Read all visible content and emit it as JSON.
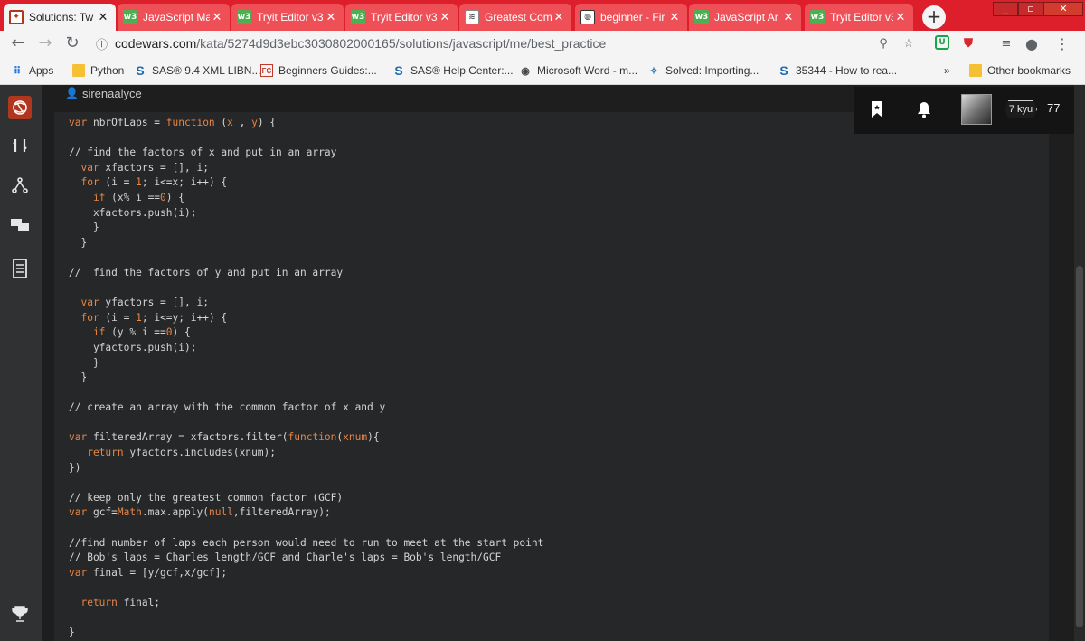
{
  "browser": {
    "tabs": [
      {
        "title": "Solutions: Tw",
        "favicon": "codewars-icon",
        "active": true
      },
      {
        "title": "JavaScript Ma",
        "favicon": "w3schools-icon",
        "active": false
      },
      {
        "title": "Tryit Editor v3",
        "favicon": "w3schools-icon",
        "active": false
      },
      {
        "title": "Tryit Editor v3",
        "favicon": "w3schools-icon",
        "active": false
      },
      {
        "title": "Greatest Com",
        "favicon": "stackoverflow-icon",
        "active": false
      },
      {
        "title": "beginner - Fir",
        "favicon": "globe-icon",
        "active": false
      },
      {
        "title": "JavaScript Ar",
        "favicon": "w3schools-icon",
        "active": false
      },
      {
        "title": "Tryit Editor v3",
        "favicon": "w3schools-icon",
        "active": false
      }
    ],
    "close_glyph": "✕",
    "new_tab_glyph": "+",
    "url_host": "codewars.com",
    "url_path": "/kata/5274d9d3ebc3030802000165/solutions/javascript/me/best_practice",
    "bookmarks": [
      {
        "label": "Apps",
        "icon": "apps-grid-icon"
      },
      {
        "label": "Python",
        "icon": "folder-icon"
      },
      {
        "label": "SAS® 9.4 XML LIBN...",
        "icon": "sas-icon"
      },
      {
        "label": "Beginners Guides:...",
        "icon": "fc-icon"
      },
      {
        "label": "SAS® Help Center:...",
        "icon": "sas-icon"
      },
      {
        "label": "Microsoft Word - m...",
        "icon": "globe-icon"
      },
      {
        "label": "Solved: Importing...",
        "icon": "sparkle-icon"
      },
      {
        "label": "35344 - How to rea...",
        "icon": "sas-icon"
      }
    ],
    "bookmarks_overflow": "»",
    "other_bookmarks": "Other bookmarks"
  },
  "page": {
    "username": "sirenaalyce",
    "rank": "7 kyu",
    "honor": "77"
  },
  "code_lines": [
    [
      [
        "kw",
        "var "
      ],
      [
        "",
        "nbrOfLaps = "
      ],
      [
        "kw",
        "function "
      ],
      [
        "",
        "("
      ],
      [
        "num",
        "x"
      ],
      [
        "",
        " , "
      ],
      [
        "num",
        "y"
      ],
      [
        "",
        ") {"
      ]
    ],
    [
      [
        "",
        ""
      ]
    ],
    [
      [
        "cm",
        "// find the factors of x and put in an array"
      ]
    ],
    [
      [
        "kw",
        "  var "
      ],
      [
        "",
        "xfactors = [], i;"
      ]
    ],
    [
      [
        "kw",
        "  for "
      ],
      [
        "",
        "(i = "
      ],
      [
        "num",
        "1"
      ],
      [
        "",
        "; i<=x; i++) {"
      ]
    ],
    [
      [
        "kw",
        "    if "
      ],
      [
        "",
        "(x% i =="
      ],
      [
        "num",
        "0"
      ],
      [
        "",
        ") {"
      ]
    ],
    [
      [
        "",
        "    xfactors.push(i);"
      ]
    ],
    [
      [
        "",
        "    }"
      ]
    ],
    [
      [
        "",
        "  }"
      ]
    ],
    [
      [
        "",
        ""
      ]
    ],
    [
      [
        "cm",
        "//  find the factors of y and put in an array"
      ]
    ],
    [
      [
        "",
        ""
      ]
    ],
    [
      [
        "kw",
        "  var "
      ],
      [
        "",
        "yfactors = [], i;"
      ]
    ],
    [
      [
        "kw",
        "  for "
      ],
      [
        "",
        "(i = "
      ],
      [
        "num",
        "1"
      ],
      [
        "",
        "; i<=y; i++) {"
      ]
    ],
    [
      [
        "kw",
        "    if "
      ],
      [
        "",
        "(y % i =="
      ],
      [
        "num",
        "0"
      ],
      [
        "",
        ") {"
      ]
    ],
    [
      [
        "",
        "    yfactors.push(i);"
      ]
    ],
    [
      [
        "",
        "    }"
      ]
    ],
    [
      [
        "",
        "  }"
      ]
    ],
    [
      [
        "",
        ""
      ]
    ],
    [
      [
        "cm",
        "// create an array with the common factor of x and y"
      ]
    ],
    [
      [
        "",
        ""
      ]
    ],
    [
      [
        "kw",
        "var "
      ],
      [
        "",
        "filteredArray = xfactors.filter("
      ],
      [
        "fn",
        "function"
      ],
      [
        "",
        "("
      ],
      [
        "num",
        "xnum"
      ],
      [
        "",
        "){"
      ]
    ],
    [
      [
        "kw",
        "   return "
      ],
      [
        "",
        "yfactors.includes(xnum);"
      ]
    ],
    [
      [
        "",
        "})"
      ]
    ],
    [
      [
        "",
        ""
      ]
    ],
    [
      [
        "cm",
        "// keep only the greatest common factor (GCF)"
      ]
    ],
    [
      [
        "kw",
        "var "
      ],
      [
        "",
        "gcf="
      ],
      [
        "fn",
        "Math"
      ],
      [
        "",
        ".max.apply("
      ],
      [
        "kw",
        "null"
      ],
      [
        "",
        ",filteredArray);"
      ]
    ],
    [
      [
        "",
        ""
      ]
    ],
    [
      [
        "cm",
        "//find number of laps each person would need to run to meet at the start point"
      ]
    ],
    [
      [
        "cm",
        "// Bob's laps = Charles length/GCF and Charle's laps = Bob's length/GCF"
      ]
    ],
    [
      [
        "kw",
        "var "
      ],
      [
        "",
        "final = [y/gcf,x/gcf];"
      ]
    ],
    [
      [
        "",
        ""
      ]
    ],
    [
      [
        "kw",
        "  return "
      ],
      [
        "",
        "final;"
      ]
    ],
    [
      [
        "",
        ""
      ]
    ],
    [
      [
        "",
        "}"
      ]
    ]
  ]
}
